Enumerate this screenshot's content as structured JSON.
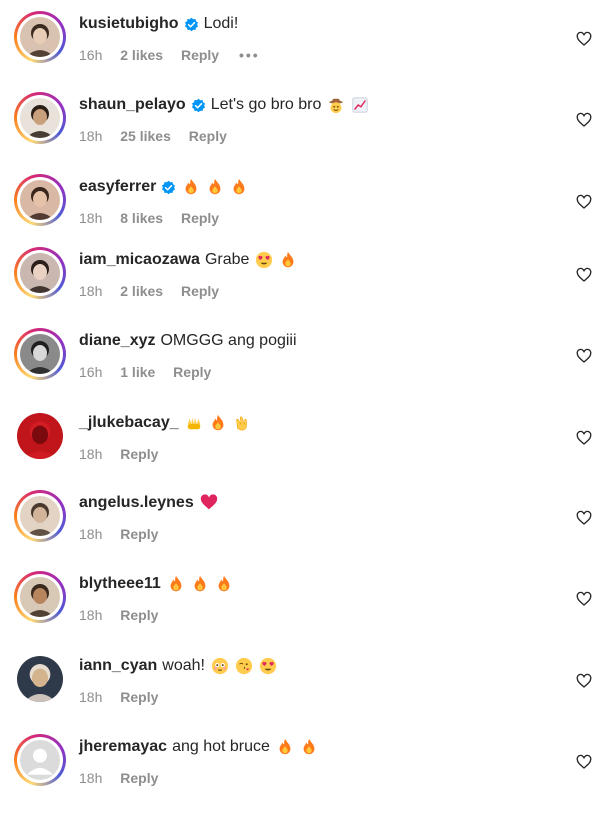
{
  "comments": [
    {
      "username": "kusietubigho",
      "verified": true,
      "text": "Lodi!",
      "emojis": [],
      "time": "16h",
      "likes": "2 likes",
      "reply": "Reply",
      "more": "•••",
      "avatar": {
        "bg": "#d9c3b0",
        "face": "#e8cdb6",
        "hair": "#3b2a20"
      },
      "story": true
    },
    {
      "username": "shaun_pelayo",
      "verified": true,
      "text": "Let's go bro bro",
      "emojis": [
        "cowboy",
        "chart"
      ],
      "time": "18h",
      "likes": "25 likes",
      "reply": "Reply",
      "avatar": {
        "bg": "#e8e2da",
        "face": "#c9a07c",
        "hair": "#2b2018"
      },
      "story": true
    },
    {
      "username": "easyferrer",
      "verified": true,
      "text": "",
      "emojis": [
        "fire",
        "fire",
        "fire"
      ],
      "time": "18h",
      "likes": "8 likes",
      "reply": "Reply",
      "avatar": {
        "bg": "#d9b9a6",
        "face": "#e6c2a8",
        "hair": "#3a261c"
      },
      "story": true
    },
    {
      "username": "iam_micaozawa",
      "verified": false,
      "text": "Grabe",
      "emojis": [
        "hearteyes",
        "fire"
      ],
      "time": "18h",
      "likes": "2 likes",
      "reply": "Reply",
      "avatar": {
        "bg": "#c9b7b0",
        "face": "#e9d2c4",
        "hair": "#2a1e1a"
      },
      "story": true
    },
    {
      "username": "diane_xyz",
      "verified": false,
      "text": "OMGGG ang pogiii",
      "emojis": [],
      "time": "16h",
      "likes": "1 like",
      "reply": "Reply",
      "avatar": {
        "bg": "#8a8a8a",
        "face": "#d8d8d8",
        "hair": "#1f1f1f"
      },
      "story": true
    },
    {
      "username": "_jlukebacay_",
      "verified": false,
      "text": "",
      "emojis": [
        "raise",
        "fire",
        "clap"
      ],
      "time": "18h",
      "likes": "",
      "reply": "Reply",
      "avatar": {
        "bg": "#c0151b",
        "face": "#7a0a0e",
        "hair": "#d01c22"
      },
      "story": false
    },
    {
      "username": "angelus.leynes",
      "verified": false,
      "text": "",
      "emojis": [
        "heart"
      ],
      "time": "18h",
      "likes": "",
      "reply": "Reply",
      "avatar": {
        "bg": "#e2d3c4",
        "face": "#d2b49a",
        "hair": "#4a3a2e"
      },
      "story": true
    },
    {
      "username": "blytheee11",
      "verified": false,
      "text": "",
      "emojis": [
        "fire",
        "fire",
        "fire"
      ],
      "time": "18h",
      "likes": "",
      "reply": "Reply",
      "avatar": {
        "bg": "#d7c9b6",
        "face": "#b8865e",
        "hair": "#3a2a1e"
      },
      "story": true
    },
    {
      "username": "iann_cyan",
      "verified": false,
      "text": "woah!",
      "emojis": [
        "flushed",
        "kiss",
        "hearteyes"
      ],
      "time": "18h",
      "likes": "",
      "reply": "Reply",
      "avatar": {
        "bg": "#2e3a4a",
        "face": "#d4b48f",
        "hair": "#e6dccf"
      },
      "story": false
    },
    {
      "username": "jheremayac",
      "verified": false,
      "text": "ang hot bruce",
      "emojis": [
        "fire",
        "fire"
      ],
      "time": "18h",
      "likes": "",
      "reply": "Reply",
      "avatar": {
        "bg": "#dbdbdb",
        "face": "#ffffff",
        "hair": "#ffffff"
      },
      "story": true
    }
  ],
  "colors": {
    "verified": "#0095f6",
    "fire": "#ff7a1a",
    "heart": "#e0245e",
    "muted": "#8e8e8e",
    "text": "#262626"
  },
  "icons": {
    "like": "heart-outline-icon",
    "verified": "verified-badge-icon"
  }
}
